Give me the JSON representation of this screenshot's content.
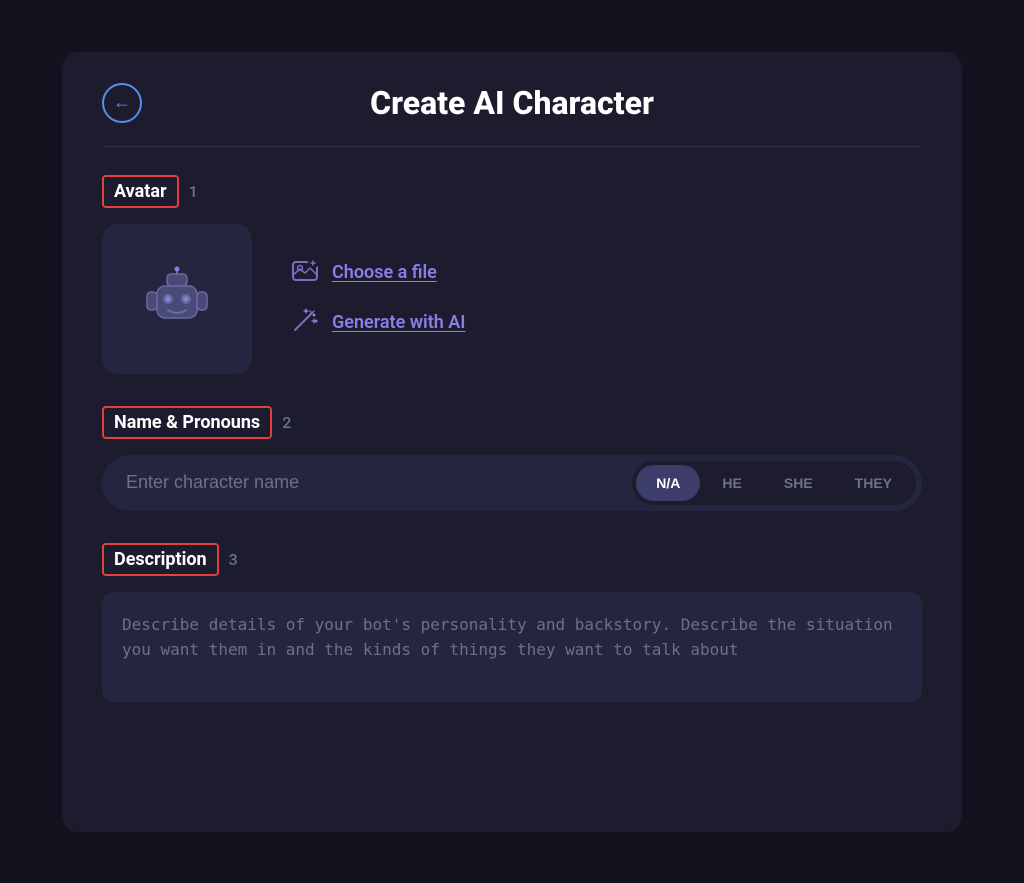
{
  "page": {
    "background_color": "#13131f",
    "card_background": "#1c1c2e"
  },
  "header": {
    "back_button_label": "←",
    "title": "Create AI Character"
  },
  "sections": {
    "avatar": {
      "label": "Avatar",
      "number": "1",
      "actions": {
        "choose_file": {
          "label": "Choose a file",
          "icon": "image-upload-icon"
        },
        "generate_ai": {
          "label": "Generate with AI",
          "icon": "magic-wand-icon"
        }
      }
    },
    "name_pronouns": {
      "label": "Name & Pronouns",
      "number": "2",
      "input_placeholder": "Enter character name",
      "pronouns": [
        "N/A",
        "HE",
        "SHE",
        "THEY"
      ],
      "active_pronoun": "N/A"
    },
    "description": {
      "label": "Description",
      "number": "3",
      "placeholder": "Describe details of your bot's personality and backstory. Describe the situation you want them in and the kinds of things they want to talk about"
    }
  }
}
